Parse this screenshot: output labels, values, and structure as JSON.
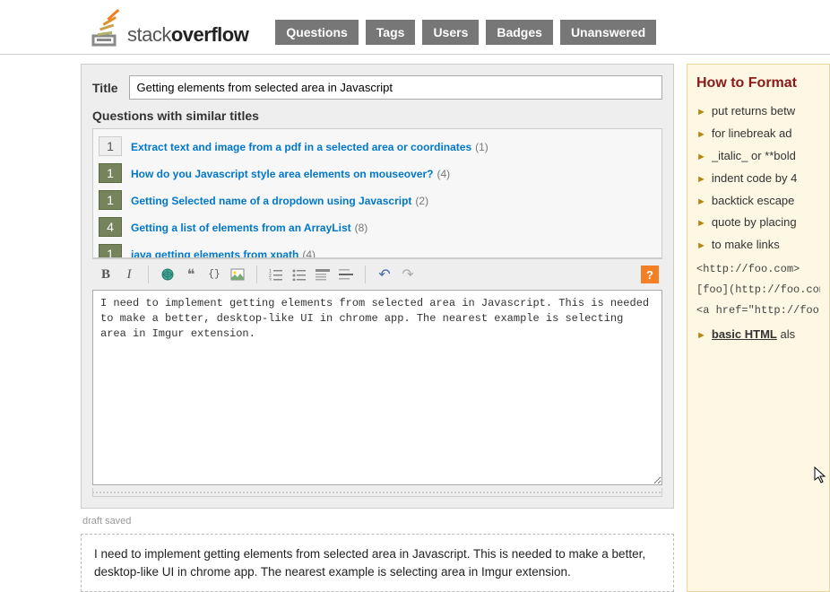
{
  "logo": {
    "text_first": "stack",
    "text_second": "overflow"
  },
  "nav": [
    "Questions",
    "Tags",
    "Users",
    "Badges",
    "Unanswered"
  ],
  "title_label": "Title",
  "title_value": "Getting elements from selected area in Javascript",
  "similar_heading": "Questions with similar titles",
  "similar": [
    {
      "votes": "1",
      "style": "gray",
      "title": "Extract text and image from a pdf in a selected area or coordinates",
      "count": "(1)"
    },
    {
      "votes": "1",
      "style": "green",
      "title": "How do you Javascript style area elements on mouseover?",
      "count": "(4)"
    },
    {
      "votes": "1",
      "style": "green",
      "title": "Getting Selected name of a dropdown using Javascript",
      "count": "(2)"
    },
    {
      "votes": "4",
      "style": "green",
      "title": "Getting a list of elements from an ArrayList",
      "count": "(8)"
    },
    {
      "votes": "1",
      "style": "green",
      "title": "java getting elements from xpath",
      "count": "(4)"
    }
  ],
  "toolbar": {
    "bold": "B",
    "italic": "I",
    "link": "🔗",
    "quote": "❝",
    "code": "{}",
    "image": "▦",
    "olist": "≣",
    "ulist": "⋮≡",
    "heading": "≡",
    "hr": "—",
    "undo": "↶",
    "redo": "↷",
    "help": "?"
  },
  "editor_text": "I need to implement getting elements from selected area in Javascript. This is needed to make a better, desktop-like UI in chrome app. The nearest example is selecting area in Imgur extension.",
  "draft_saved": "draft saved",
  "preview_text": "I need to implement getting elements from selected area in Javascript. This is needed to make a better, desktop-like UI in chrome app. The nearest example is selecting area in Imgur extension.",
  "format": {
    "title": "How to Format",
    "tips": [
      "put returns betw",
      "for linebreak ad",
      "_italic_ or **bold",
      "indent code by 4",
      "backtick escape",
      "quote by placing",
      "to make links"
    ],
    "code1": "<http://foo.com>",
    "code2": "[foo](http://foo.com",
    "code3": "<a href=\"http://foo.",
    "basic_html_label": "basic HTML",
    "basic_html_rest": " als"
  }
}
